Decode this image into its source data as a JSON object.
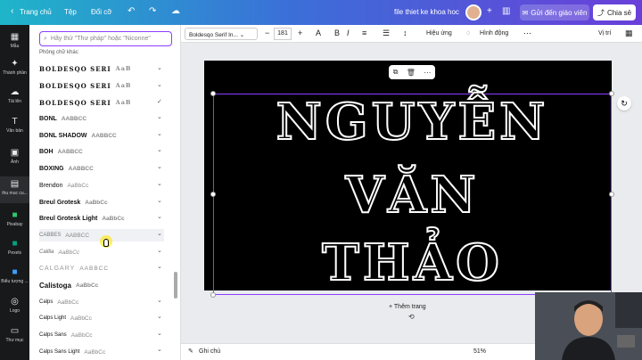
{
  "topbar": {
    "home": "Trang chủ",
    "file": "Tệp",
    "resize": "Đổi cỡ",
    "doc_title": "file thiet ke khoa hoc",
    "teacher_button": "Gửi đến giáo viên",
    "share_button": "Chia sẻ"
  },
  "rail": [
    {
      "label": "Mẫu",
      "icon": "template-icon"
    },
    {
      "label": "Thành phần",
      "icon": "elements-icon"
    },
    {
      "label": "Tải lên",
      "icon": "upload-icon"
    },
    {
      "label": "Văn bản",
      "icon": "text-icon"
    },
    {
      "label": "Ảnh",
      "icon": "photo-icon"
    },
    {
      "label": "thu muc cu...",
      "icon": "folder-icon"
    },
    {
      "label": "Pixabay",
      "icon": "pixabay-icon"
    },
    {
      "label": "Pexels",
      "icon": "pexels-icon"
    },
    {
      "label": "Biểu tượng ...",
      "icon": "icons-icon"
    },
    {
      "label": "Logo",
      "icon": "logo-icon"
    },
    {
      "label": "Thư mục",
      "icon": "folder-icon"
    }
  ],
  "panel": {
    "search_placeholder": "Hãy thử \"Thư pháp\" hoặc \"Niconne\"",
    "category": "Phông chữ khác",
    "fonts": [
      {
        "name": "BOLDESQO SERI",
        "sample": "AaB"
      },
      {
        "name": "BOLDESQO SERI",
        "sample": "AaB"
      },
      {
        "name": "BOLDESQO SERI",
        "sample": "AaB"
      },
      {
        "name": "BONL",
        "sample": "AABBCC"
      },
      {
        "name": "BONL SHADOW",
        "sample": "AABBCC"
      },
      {
        "name": "BOH",
        "sample": "AABBCC"
      },
      {
        "name": "BOXING",
        "sample": "AABBCC"
      },
      {
        "name": "Brendon",
        "sample": "AaBbCc"
      },
      {
        "name": "Breul Grotesk",
        "sample": "AaBbCc"
      },
      {
        "name": "Breul Grotesk Light",
        "sample": "AaBbCc"
      },
      {
        "name": "CABBES",
        "sample": "AABBCC"
      },
      {
        "name": "Caillia",
        "sample": "AaBbCc"
      },
      {
        "name": "CALGARY",
        "sample": "AABBCC"
      },
      {
        "name": "Calistoga",
        "sample": "AaBbCc"
      },
      {
        "name": "Calps",
        "sample": "AaBbCc"
      },
      {
        "name": "Calps Light",
        "sample": "AaBbCc"
      },
      {
        "name": "Calps Sans",
        "sample": "AaBbCc"
      },
      {
        "name": "Calps Sans Light",
        "sample": "AaBbCc"
      }
    ]
  },
  "toolbar": {
    "font_name": "Boldesqo Serif In...",
    "font_size": "181",
    "effects": "Hiệu ứng",
    "animate": "Hình động",
    "position": "Vị trí"
  },
  "canvas": {
    "lines": [
      "NGUYỄN",
      "VĂN",
      "THẢO"
    ],
    "add_page": "+ Thêm trang"
  },
  "bottom": {
    "notes": "Ghi chú",
    "zoom": "51%"
  }
}
